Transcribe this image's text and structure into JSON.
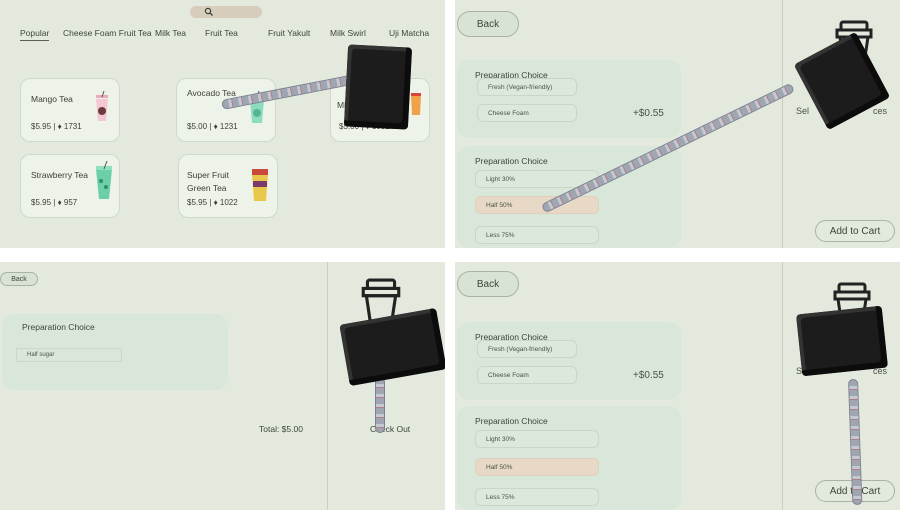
{
  "menu": {
    "tabs": [
      "Popular",
      "Cheese Foam Fruit Tea",
      "Milk Tea",
      "Fruit Tea",
      "Fruit Yakult",
      "Milk Swirl",
      "Uji Matcha"
    ],
    "active_tab": "Popular",
    "products": [
      {
        "name": "Mango Tea",
        "price": "$5.95",
        "likes": "1731"
      },
      {
        "name": "Avocado Tea",
        "price": "$5.00",
        "likes": "1231"
      },
      {
        "name": "Mil",
        "price": "$5.00",
        "likes": "1931"
      },
      {
        "name": "Strawberry Tea",
        "price": "$5.95",
        "likes": "957"
      },
      {
        "name": "Super Fruit Green Tea",
        "price": "$5.95",
        "likes": "1022"
      }
    ]
  },
  "detail": {
    "back_label": "Back",
    "sections": [
      {
        "heading": "Preparation Choice",
        "options": [
          "Fresh (Vegan-friendly)",
          "Cheese Foam"
        ],
        "price": "+$0.55"
      },
      {
        "heading": "Preparation Choice",
        "options": [
          "Light 30%",
          "Half 50%",
          "Less 75%"
        ],
        "selected": "Half 50%"
      }
    ],
    "sidebar_text_left": "Sel",
    "sidebar_text_right": "ces",
    "add_to_cart_label": "Add to Cart"
  },
  "cart": {
    "back_label": "Back",
    "heading": "Preparation Choice",
    "item": "Half sugar",
    "total": "Total: $5.00",
    "checkout_label": "Check Out"
  },
  "colors": {
    "background": "#e3eadd",
    "card": "#eef3ea",
    "section": "#d8e7d9",
    "selected_option": "#e8d9c6",
    "search_bar": "#d6cdbd"
  }
}
